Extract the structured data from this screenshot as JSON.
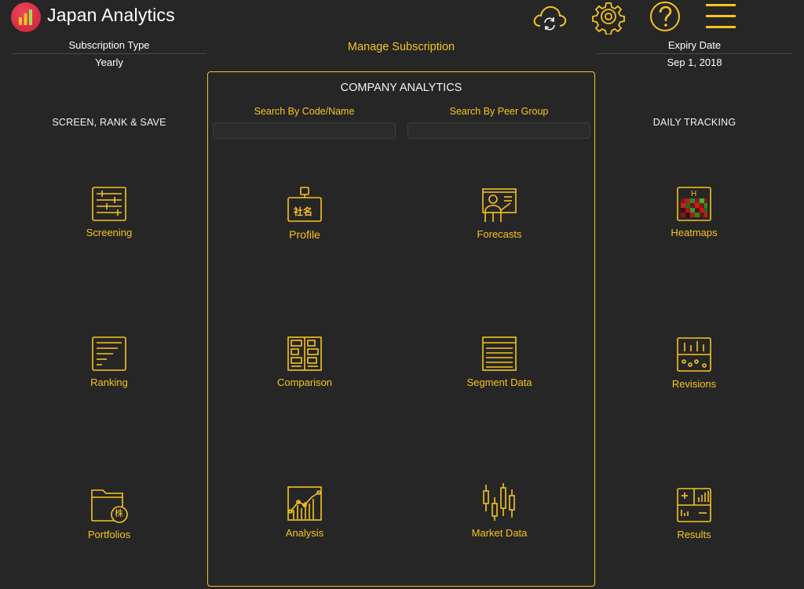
{
  "header": {
    "app_title": "Japan Analytics",
    "icons": [
      "sync-cloud-icon",
      "settings-gear-icon",
      "help-icon",
      "menu-icon"
    ]
  },
  "subscription": {
    "type_label": "Subscription Type",
    "type_value": "Yearly",
    "manage_label": "Manage Subscription",
    "expiry_label": "Expiry Date",
    "expiry_value": "Sep 1, 2018"
  },
  "left_column": {
    "heading": "SCREEN, RANK & SAVE",
    "items": [
      {
        "label": "Screening",
        "icon": "screening-icon"
      },
      {
        "label": "Ranking",
        "icon": "ranking-icon"
      },
      {
        "label": "Portfolios",
        "icon": "portfolios-icon"
      }
    ]
  },
  "center_column": {
    "heading": "COMPANY ANALYTICS",
    "search_code_label": "Search By Code/Name",
    "search_peer_label": "Search By Peer Group",
    "search_code_value": "",
    "search_peer_value": "",
    "items": [
      {
        "label": "Profile",
        "icon": "profile-badge-icon"
      },
      {
        "label": "Forecasts",
        "icon": "forecasts-presenter-icon"
      },
      {
        "label": "Comparison",
        "icon": "comparison-icon"
      },
      {
        "label": "Segment Data",
        "icon": "segment-data-icon"
      },
      {
        "label": "Analysis",
        "icon": "analysis-chart-icon"
      },
      {
        "label": "Market Data",
        "icon": "candlestick-icon"
      }
    ],
    "profile_icon_text": "社名"
  },
  "right_column": {
    "heading": "DAILY TRACKING",
    "items": [
      {
        "label": "Heatmaps",
        "icon": "heatmaps-icon"
      },
      {
        "label": "Revisions",
        "icon": "revisions-icon"
      },
      {
        "label": "Results",
        "icon": "results-icon"
      }
    ]
  },
  "portfolio_icon_text": "株",
  "colors": {
    "background": "#262626",
    "accent": "#f7c31e",
    "logo": "#e3314a"
  }
}
